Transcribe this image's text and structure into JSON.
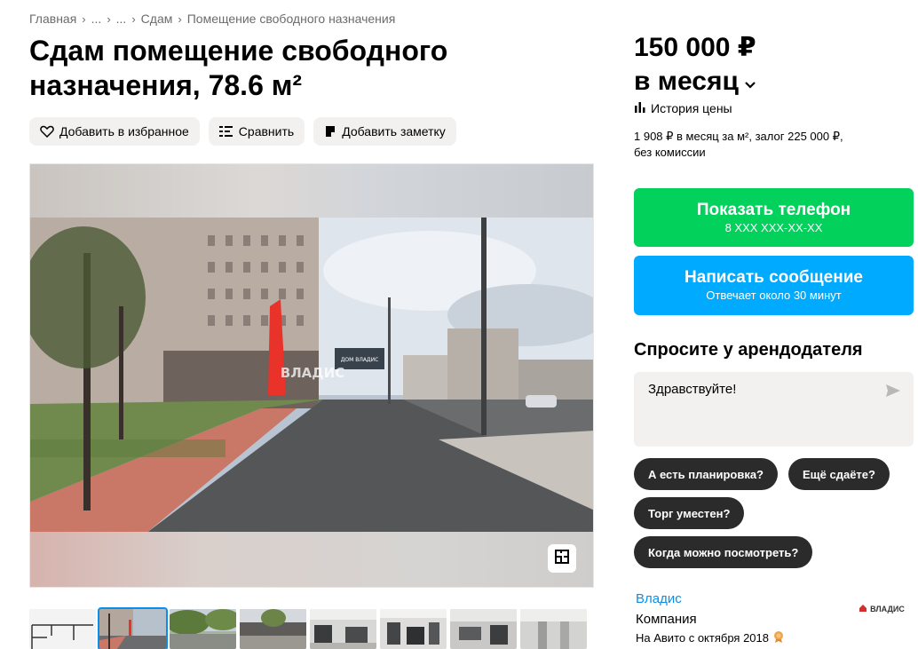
{
  "breadcrumb": [
    "Главная",
    "...",
    "...",
    "Сдам",
    "Помещение свободного назначения"
  ],
  "title": "Сдам помещение свободного назначения, 78.6 м²",
  "actions": {
    "favorite": "Добавить в избранное",
    "compare": "Сравнить",
    "note": "Добавить заметку"
  },
  "gallery": {
    "watermark": "ВЛАДИС",
    "billboard": "ДОМ ВЛАДИС",
    "thumbnail_count": 8,
    "active_thumbnail": 2
  },
  "price": {
    "amount": "150 000 ₽",
    "period": "в месяц",
    "history_label": "История цены",
    "details_line1": "1 908 ₽ в месяц за м², залог 225 000 ₽,",
    "details_line2": "без комиссии"
  },
  "contact": {
    "phone_label": "Показать телефон",
    "phone_masked": "8 XXX XXX-XX-XX",
    "message_label": "Написать сообщение",
    "message_sub": "Отвечает около 30 минут"
  },
  "ask": {
    "title": "Спросите у арендодателя",
    "input_value": "Здравствуйте!",
    "chips": [
      "А есть планировка?",
      "Ещё сдаёте?",
      "Торг уместен?",
      "Когда можно посмотреть?"
    ]
  },
  "seller": {
    "name": "Владис",
    "type": "Компания",
    "since": "На Авито с октября 2018",
    "logo_text": "ВЛАДИС"
  },
  "colors": {
    "green": "#02d15c",
    "blue": "#00aaff",
    "chip": "#2b2b2b",
    "link": "#0a8ee8"
  }
}
